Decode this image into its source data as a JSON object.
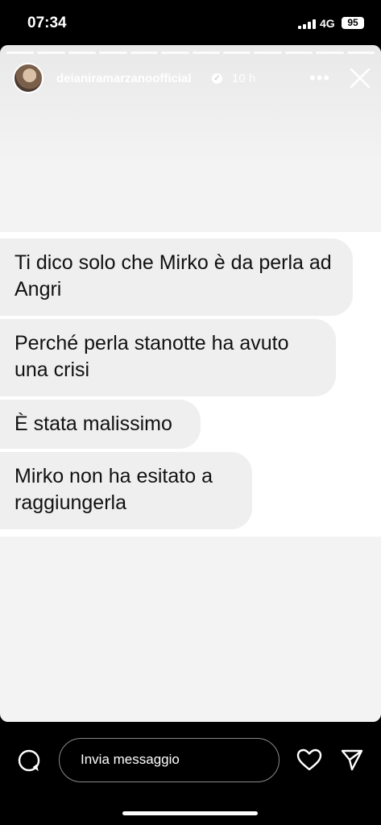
{
  "status_bar": {
    "time": "07:34",
    "network": "4G",
    "battery": "95"
  },
  "story": {
    "progress_segments": 12,
    "username": "deianiramarzanoofficial",
    "time_ago": "10 h",
    "more_label": "•••"
  },
  "messages": [
    "Ti dico solo che Mirko è da perla ad Angri",
    "Perché perla stanotte ha avuto una crisi",
    "È stata malissimo",
    "Mirko non ha esitato a raggiungerla"
  ],
  "reply_bar": {
    "placeholder": "Invia messaggio"
  },
  "icons": {
    "camera": "camera-icon",
    "heart": "heart-icon",
    "send": "send-icon",
    "close": "close-icon",
    "verified": "verified-badge-icon"
  },
  "colors": {
    "bubble": "#efefef",
    "background": "#000000",
    "story_bg": "#f3f3f3"
  }
}
